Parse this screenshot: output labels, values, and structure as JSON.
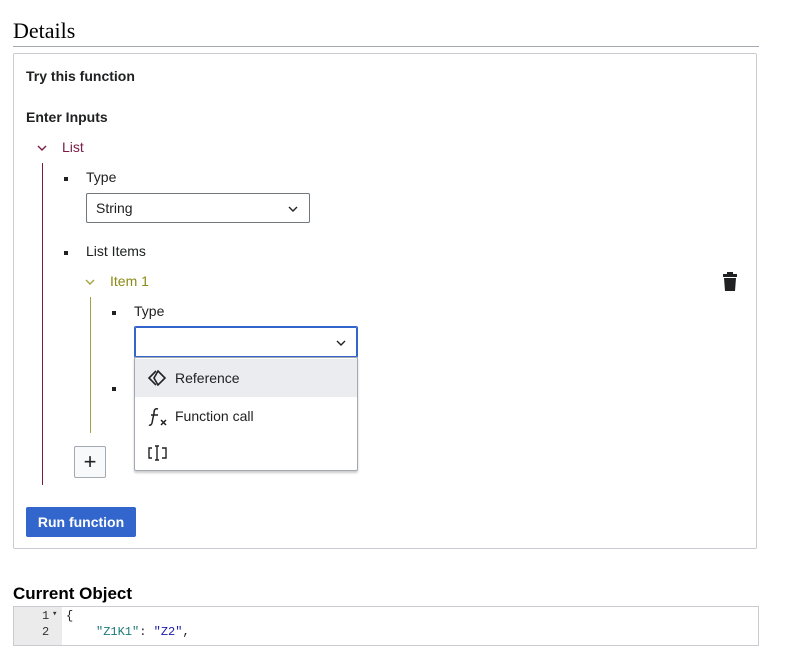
{
  "heading": "Details",
  "panel": {
    "title": "Try this function",
    "inputs_heading": "Enter Inputs",
    "list": {
      "label": "List",
      "type_label": "Type",
      "type_value": "String",
      "items_label": "List Items",
      "item": {
        "label": "Item 1",
        "type_label": "Type",
        "type_value": "",
        "menu": [
          {
            "label": "Reference",
            "icon": "reference-icon"
          },
          {
            "label": "Function call",
            "icon": "function-call-icon"
          },
          {
            "label": "",
            "icon": "text-cursor-icon"
          }
        ]
      }
    },
    "add_label": "+",
    "run_label": "Run function"
  },
  "current_object": {
    "title": "Current Object",
    "lines": [
      {
        "num": "1",
        "fold": "▾",
        "text": "{"
      },
      {
        "num": "2",
        "key": "\"Z1K1\"",
        "sep": ": ",
        "value": "\"Z2\"",
        "trail": ","
      }
    ]
  },
  "colors": {
    "accent": "#3366cc",
    "list_color": "#7a1c45",
    "item_color": "#8a8a16"
  }
}
